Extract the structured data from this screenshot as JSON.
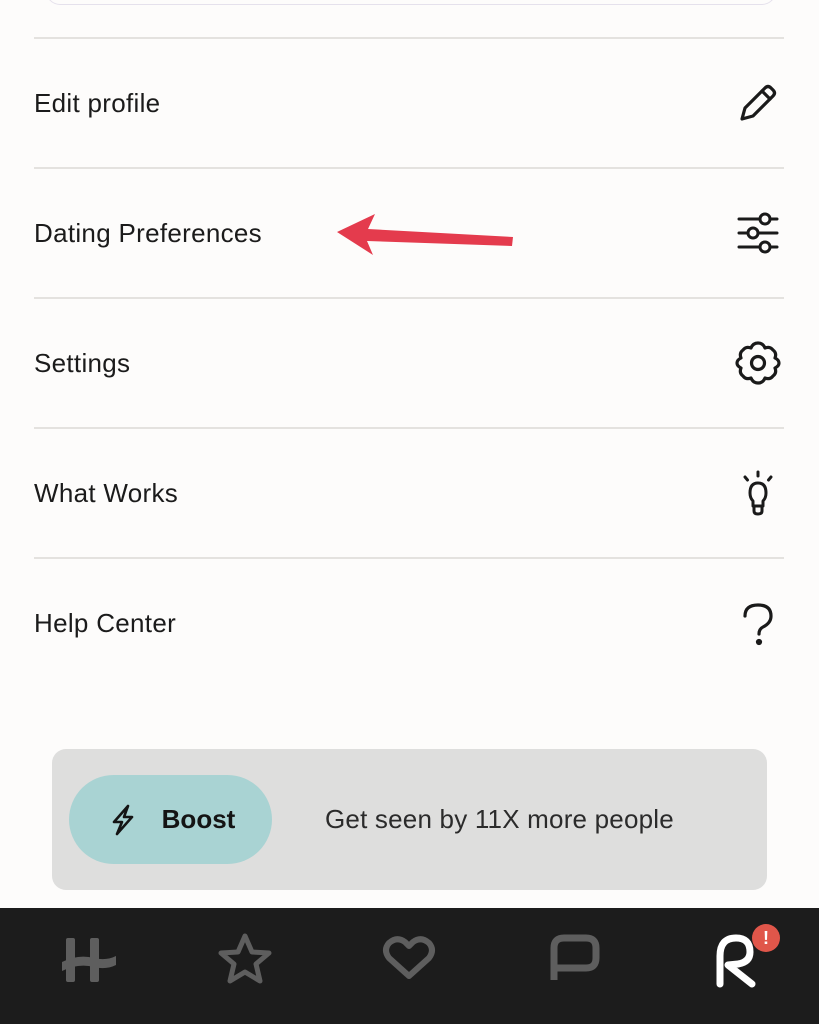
{
  "menu": {
    "items": [
      {
        "label": "Edit profile",
        "icon": "pencil-icon"
      },
      {
        "label": "Dating Preferences",
        "icon": "sliders-icon"
      },
      {
        "label": "Settings",
        "icon": "gear-icon"
      },
      {
        "label": "What Works",
        "icon": "lightbulb-icon"
      },
      {
        "label": "Help Center",
        "icon": "question-icon"
      }
    ]
  },
  "boost": {
    "button_label": "Boost",
    "description": "Get seen by 11X more people",
    "icon": "lightning-icon"
  },
  "nav": {
    "items": [
      {
        "icon": "hinge-logo-icon"
      },
      {
        "icon": "star-icon"
      },
      {
        "icon": "heart-icon"
      },
      {
        "icon": "chat-bubble-icon"
      },
      {
        "icon": "profile-icon",
        "active": true
      }
    ],
    "profile_badge": "!"
  },
  "colors": {
    "background": "#fdfcfb",
    "divider": "#e4e2df",
    "boost_card": "#dededd",
    "boost_button": "#a9d3d3",
    "nav_bar": "#1c1c1c",
    "nav_inactive_icon": "#5e5e5e",
    "nav_active_icon": "#ffffff",
    "badge": "#e0564a",
    "annotation_arrow": "#e43b4d"
  }
}
